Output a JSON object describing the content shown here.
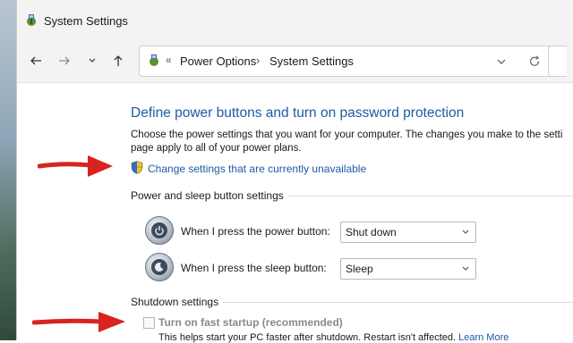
{
  "window": {
    "title": "System Settings"
  },
  "nav": {
    "back_icon": "arrow-left-icon",
    "forward_icon": "arrow-right-icon",
    "recent_icon": "chevron-down-icon",
    "up_icon": "arrow-up-icon",
    "address_separator": "«",
    "breadcrumb": [
      "Power Options",
      "System Settings"
    ],
    "breadcrumb_separator": "›"
  },
  "page": {
    "heading": "Define power buttons and turn on password protection",
    "description_line1": "Choose the power settings that you want for your computer. The changes you make to the setti",
    "description_line2": "page apply to all of your power plans.",
    "change_settings_link": "Change settings that are currently unavailable",
    "power_sleep_section": "Power and sleep button settings",
    "power_button_label": "When I press the power button:",
    "power_button_value": "Shut down",
    "sleep_button_label": "When I press the sleep button:",
    "sleep_button_value": "Sleep",
    "shutdown_section": "Shutdown settings",
    "fast_startup_label": "Turn on fast startup (recommended)",
    "fast_startup_checked": false,
    "fast_startup_help": "This helps start your PC faster after shutdown. Restart isn't affected.",
    "learn_more": "Learn More"
  },
  "colors": {
    "link": "#1f5aa6",
    "annotation_arrow": "#d9231f"
  }
}
